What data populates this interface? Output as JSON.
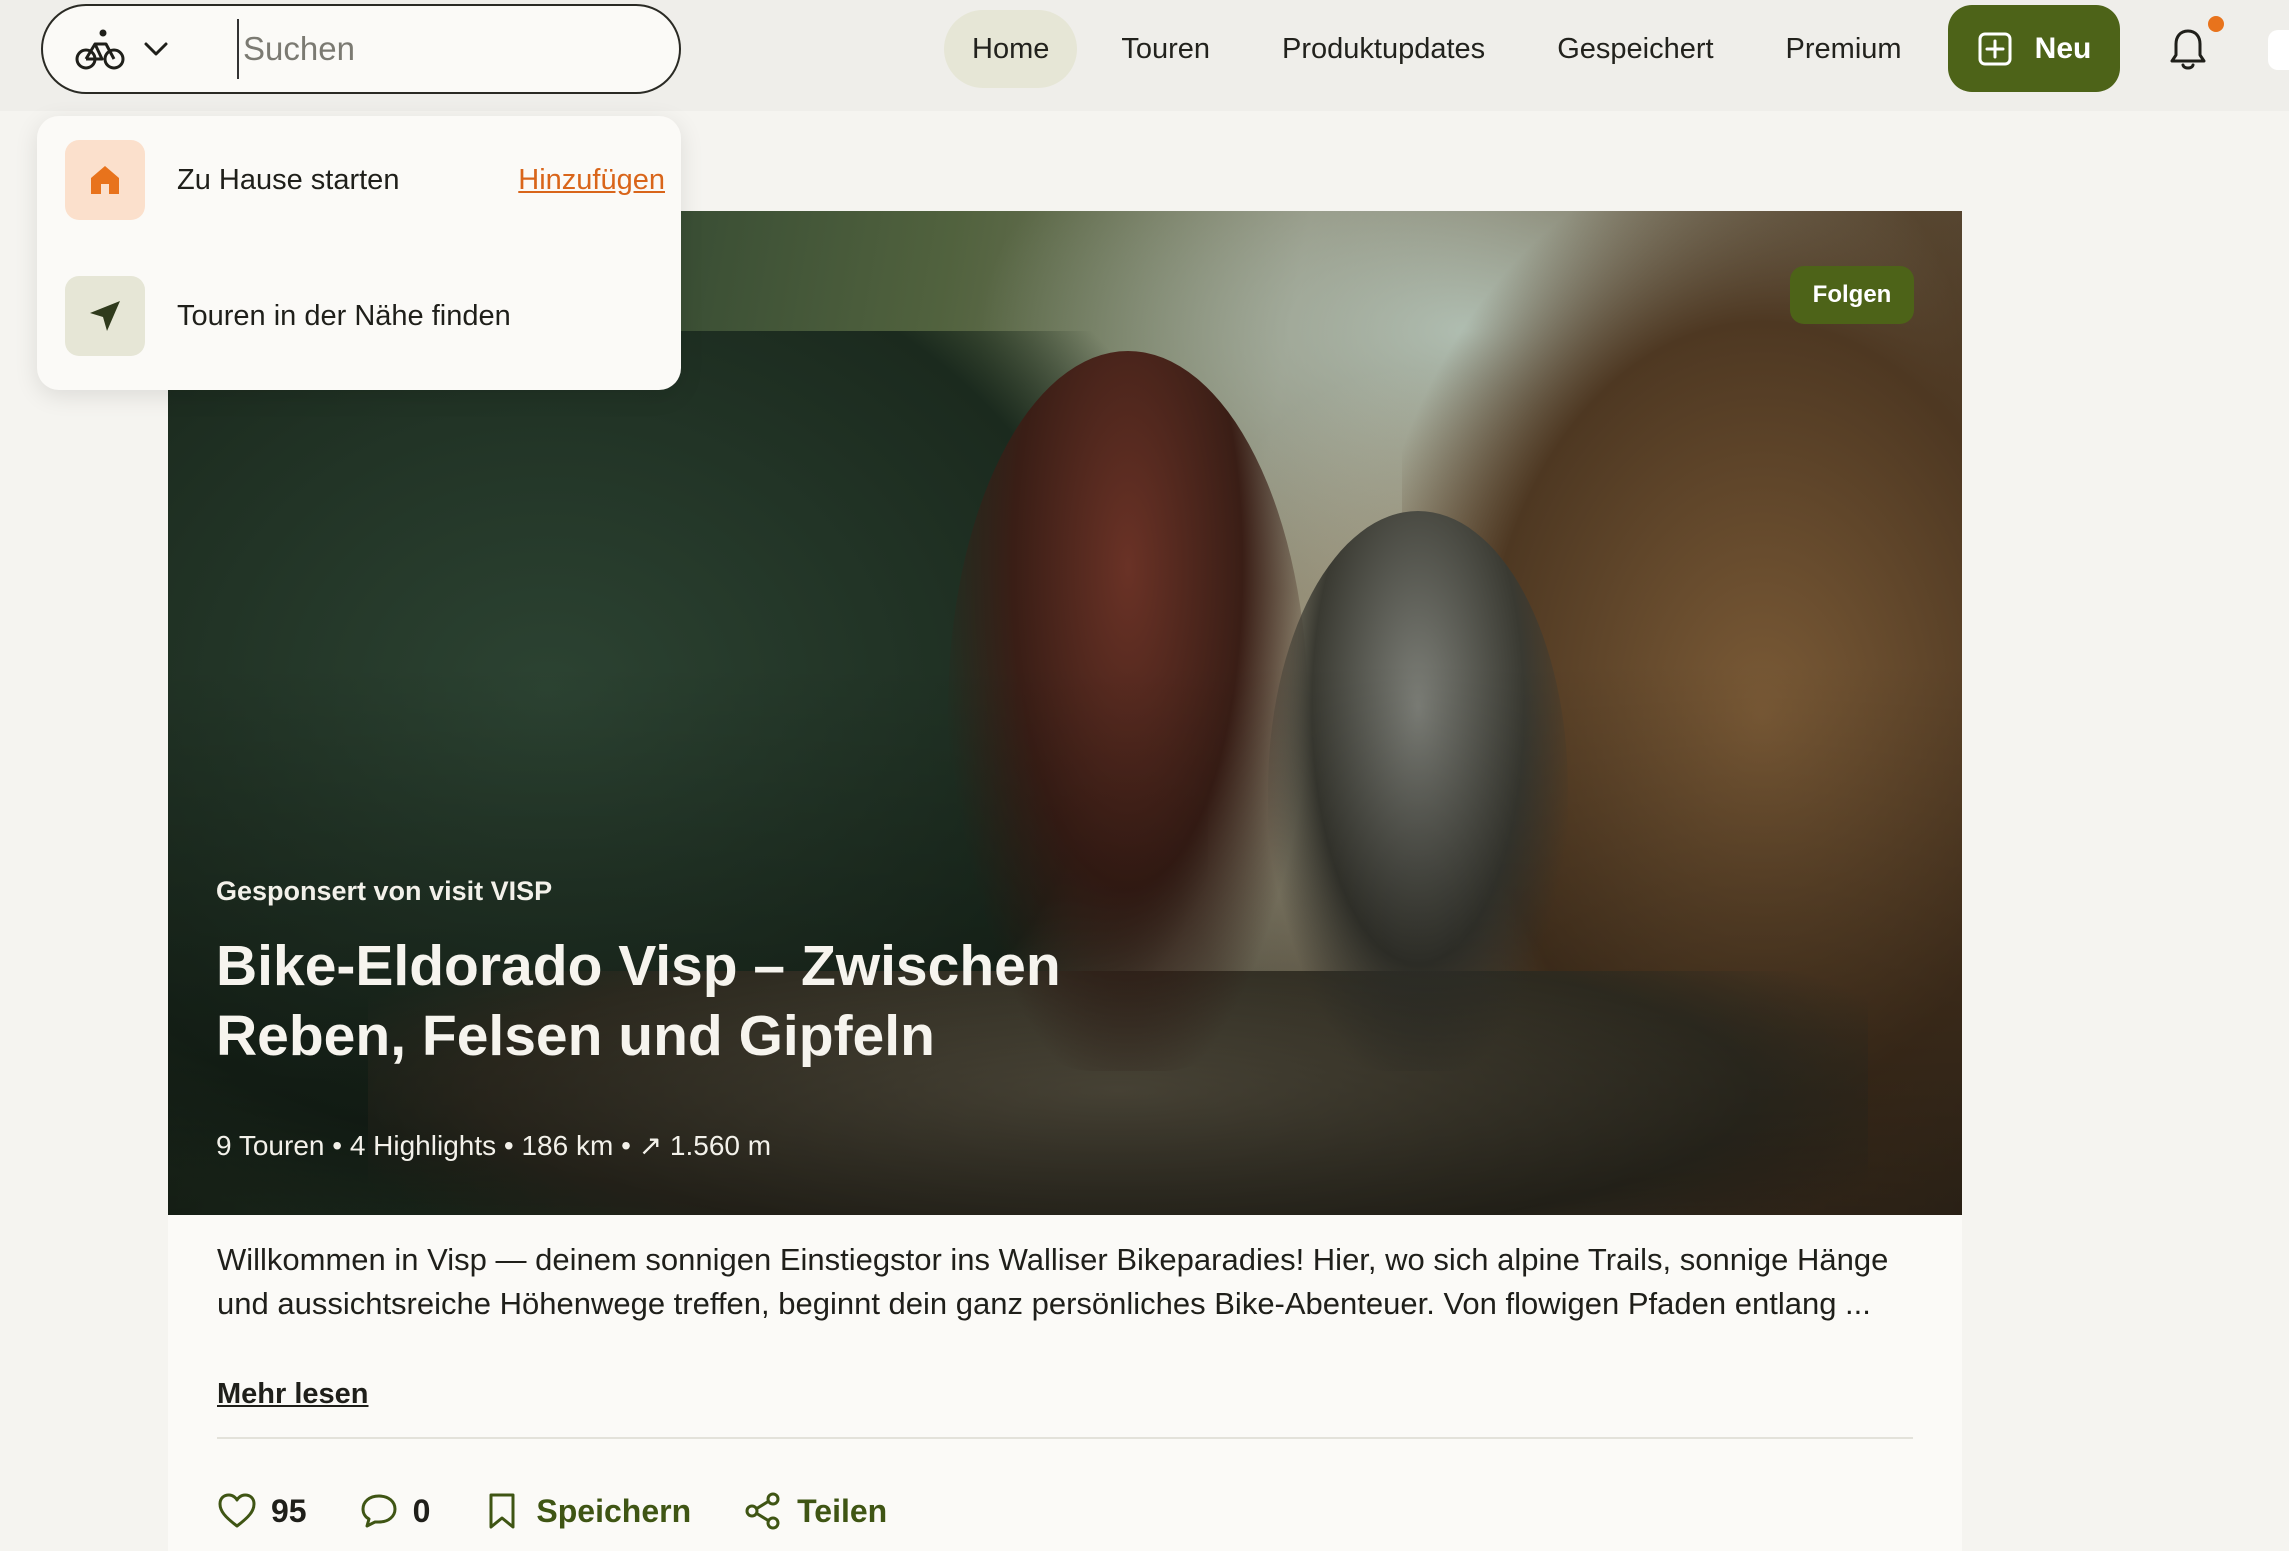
{
  "colors": {
    "accent_green": "#4d6318",
    "accent_orange": "#d9651a",
    "notification_dot": "#e8731c"
  },
  "search": {
    "sport_icon": "bike-icon",
    "placeholder": "Suchen",
    "value": ""
  },
  "nav": {
    "items": [
      {
        "label": "Home",
        "active": true
      },
      {
        "label": "Touren",
        "active": false
      },
      {
        "label": "Produktupdates",
        "active": false
      },
      {
        "label": "Gespeichert",
        "active": false
      },
      {
        "label": "Premium",
        "active": false
      }
    ],
    "new_label": "Neu"
  },
  "dropdown": {
    "home": {
      "label": "Zu Hause starten",
      "action": "Hinzufügen"
    },
    "nearby": {
      "label": "Touren in der Nähe finden"
    }
  },
  "post": {
    "follow_label": "Folgen",
    "sponsor": "Gesponsert von visit VISP",
    "title": "Bike-Eldorado Visp – Zwischen Reben, Felsen und Gipfeln",
    "stats": "9 Touren • 4 Highlights • 186 km • ↗ 1.560 m",
    "description": "Willkommen in Visp — deinem sonnigen Einstiegstor ins Walliser Bikeparadies! Hier, wo sich alpine Trails, sonnige Hänge und aussichtsreiche Höhenwege treffen, beginnt dein ganz persönliches Bike-Abenteuer. Von flowigen Pfaden entlang ...",
    "more_label": "Mehr lesen",
    "likes": "95",
    "comments": "0",
    "save_label": "Speichern",
    "share_label": "Teilen"
  }
}
